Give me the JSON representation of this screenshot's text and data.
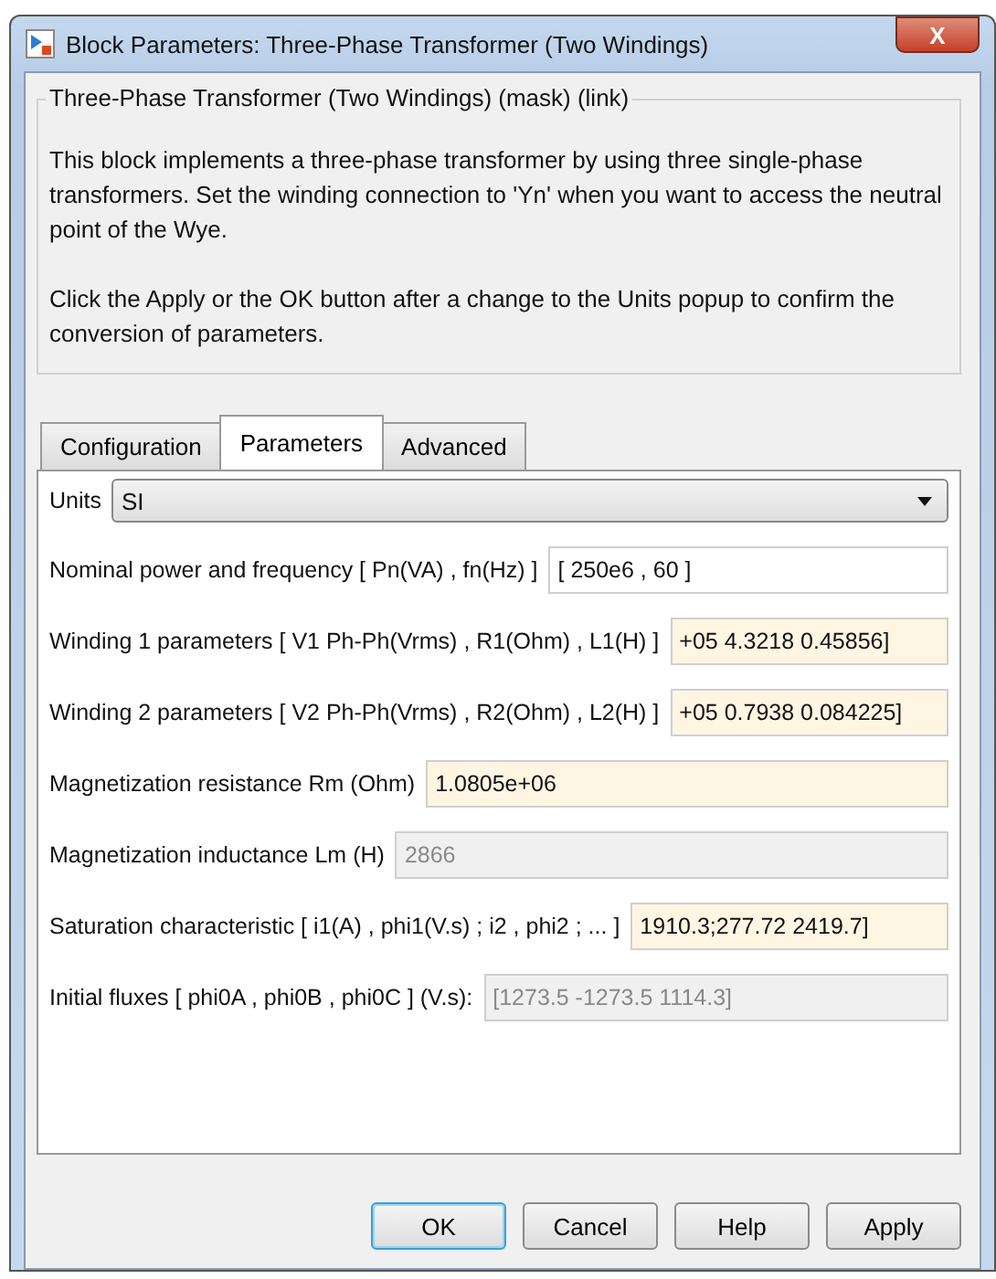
{
  "window": {
    "title": "Block Parameters: Three-Phase Transformer (Two Windings)",
    "close": "X"
  },
  "group_title": "Three-Phase Transformer (Two Windings) (mask) (link)",
  "description": [
    "This block implements a three-phase transformer by using three single-phase transformers. Set the winding connection to 'Yn'  when you want to access the neutral point of the Wye.",
    "Click the Apply or the OK button after a change to the Units popup to confirm the conversion of parameters."
  ],
  "tabs": [
    {
      "label": "Configuration",
      "selected": false
    },
    {
      "label": "Parameters",
      "selected": true
    },
    {
      "label": "Advanced",
      "selected": false
    }
  ],
  "units": {
    "label": "Units",
    "value": "SI"
  },
  "parameters": [
    {
      "label": "Nominal power and frequency  [ Pn(VA) , fn(Hz) ]",
      "value": "[ 250e6 , 60 ]",
      "highlighted": false,
      "disabled": false
    },
    {
      "label": "Winding 1 parameters [ V1 Ph-Ph(Vrms) , R1(Ohm) , L1(H) ]",
      "value": "+05 4.3218 0.45856]",
      "highlighted": true,
      "disabled": false
    },
    {
      "label": "Winding 2 parameters [ V2 Ph-Ph(Vrms) , R2(Ohm) , L2(H) ]",
      "value": "+05 0.7938 0.084225]",
      "highlighted": true,
      "disabled": false
    },
    {
      "label": "Magnetization resistance  Rm (Ohm)",
      "value": "1.0805e+06",
      "highlighted": true,
      "disabled": false
    },
    {
      "label": "Magnetization inductance  Lm (H)",
      "value": "2866",
      "highlighted": false,
      "disabled": true
    },
    {
      "label": "Saturation characteristic [ i1(A) ,  phi1(V.s) ;  i2 , phi2 ; ... ]",
      "value": "1910.3;277.72 2419.7]",
      "highlighted": true,
      "disabled": false
    },
    {
      "label": "Initial fluxes [ phi0A , phi0B , phi0C ] (V.s):",
      "value": "[1273.5 -1273.5 1114.3]",
      "highlighted": false,
      "disabled": true
    }
  ],
  "buttons": [
    {
      "label": "OK",
      "selected": true
    },
    {
      "label": "Cancel",
      "selected": false
    },
    {
      "label": "Help",
      "selected": false
    },
    {
      "label": "Apply",
      "selected": false
    }
  ]
}
